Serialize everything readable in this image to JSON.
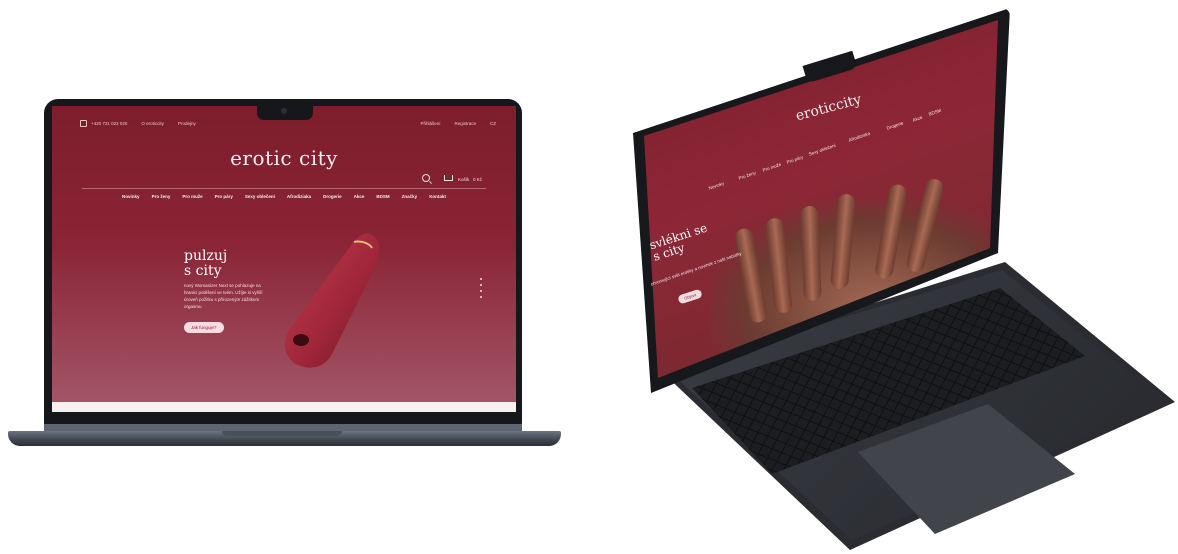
{
  "left_screen": {
    "topbar": {
      "phone": "+420 721 022 020",
      "links": [
        "O eroticcity",
        "Prodejny"
      ],
      "right_links": [
        "Přihlášení",
        "Registrace",
        "CZ"
      ]
    },
    "logo": "erotic city",
    "utility": {
      "cart_label": "Košík",
      "cart_value": "0 Kč"
    },
    "nav": [
      "Novinky",
      "Pro ženy",
      "Pro muže",
      "Pro páry",
      "Sexy oblečení",
      "Afrodiziaka",
      "Drogerie",
      "Akce",
      "BDSM",
      "Značky",
      "Kontakt"
    ],
    "hero": {
      "title_line1": "pulzuj",
      "title_line2": "s city",
      "text": "nový Womanizer Next se pohlazuje na hranici potěšení ve tvém. Užijte si vyšší úroveň požitku s přirozeným zážitkem orgasmu",
      "cta": "Jak funguje?"
    }
  },
  "right_screen": {
    "logo": "eroticcity",
    "hero_title_line1": "svlékni se",
    "hero_title_line2": "s city",
    "hero_text": "ohromující svět erotiky a novinek z naší nabídky",
    "cta": "Objevit",
    "nav": [
      "Novinky",
      "Pro ženy",
      "Pro muže",
      "Pro páry",
      "Sexy oblečení",
      "Afrodiziaka",
      "Drogerie",
      "Akce",
      "BDSM",
      "Značky"
    ]
  }
}
